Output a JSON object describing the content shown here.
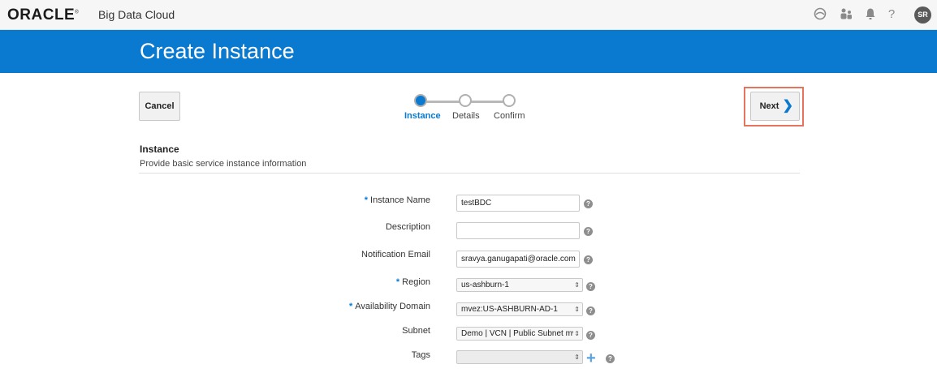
{
  "header": {
    "brand": "ORACLE",
    "brand_mark": "®",
    "product": "Big Data Cloud",
    "icons": [
      "cloud-account-icon",
      "users-icon",
      "bell-icon",
      "help-icon"
    ],
    "help_glyph": "?",
    "avatar_initials": "SR"
  },
  "banner": {
    "title": "Create Instance"
  },
  "toolbar": {
    "cancel_label": "Cancel",
    "next_label": "Next",
    "next_chevron": "❯"
  },
  "train": {
    "steps": [
      {
        "label": "Instance",
        "active": true
      },
      {
        "label": "Details",
        "active": false
      },
      {
        "label": "Confirm",
        "active": false
      }
    ]
  },
  "section": {
    "title": "Instance",
    "subtitle": "Provide basic service instance information"
  },
  "form": {
    "required_marker": "*",
    "help_glyph": "?",
    "select_arrow": "⇕",
    "add_glyph": "+",
    "instance_name": {
      "label": "Instance Name",
      "value": "testBDC",
      "required": true
    },
    "description": {
      "label": "Description",
      "value": "",
      "required": false
    },
    "notification_email": {
      "label": "Notification Email",
      "value": "sravya.ganugapati@oracle.com",
      "required": false
    },
    "region": {
      "label": "Region",
      "value": "us-ashburn-1",
      "required": true
    },
    "availability_domain": {
      "label": "Availability Domain",
      "value": "mvez:US-ASHBURN-AD-1",
      "required": true
    },
    "subnet": {
      "label": "Subnet",
      "value": "Demo | VCN | Public Subnet mv",
      "required": false
    },
    "tags": {
      "label": "Tags",
      "value": "",
      "required": false
    }
  },
  "colors": {
    "accent": "#0a7ad0",
    "highlight": "#e5745f"
  }
}
